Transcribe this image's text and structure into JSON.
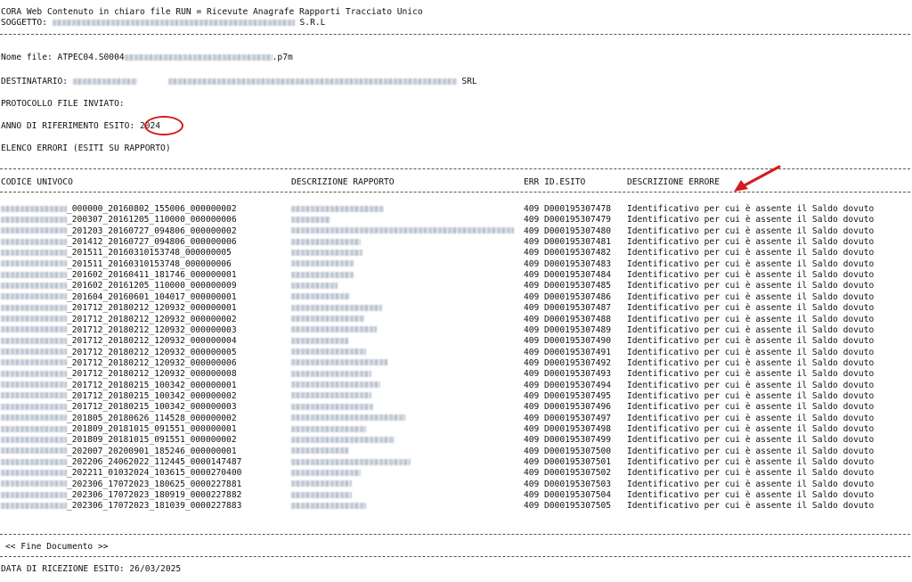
{
  "header": {
    "title": "CORA Web Contenuto in chiaro file RUN = Ricevute Anagrafe Rapporti Tracciato Unico",
    "subject_label": "SOGGETTO:",
    "subject_suffix": "S.R.L"
  },
  "info": {
    "file_name_label": "Nome file:",
    "file_name_prefix": "ATPEC04.S0004",
    "file_name_suffix": ".p7m",
    "recipient_label": "DESTINATARIO:",
    "recipient_suffix": "SRL",
    "protocol_label": "PROTOCOLLO FILE INVIATO:",
    "year_label": "ANNO DI RIFERIMENTO ESITO:",
    "year_value": "2024",
    "errors_heading": "ELENCO ERRORI (ESITI SU RAPPORTO)"
  },
  "table": {
    "headers": {
      "code": "CODICE UNIVOCO",
      "description": "DESCRIZIONE RAPPORTO",
      "err_id": "ERR ID.ESITO",
      "error_description": "DESCRIZIONE ERRORE"
    },
    "rows": [
      {
        "code": "_000000_20160802_155006_000000002",
        "err": "409",
        "id": "D000195307478",
        "msg": "Identificativo per cui è assente il Saldo dovuto"
      },
      {
        "code": "_200307_20161205_110000_000000006",
        "err": "409",
        "id": "D000195307479",
        "msg": "Identificativo per cui è assente il Saldo dovuto"
      },
      {
        "code": "_201203_20160727_094806_000000002",
        "err": "409",
        "id": "D000195307480",
        "msg": "Identificativo per cui è assente il Saldo dovuto"
      },
      {
        "code": "_201412_20160727_094806_000000006",
        "err": "409",
        "id": "D000195307481",
        "msg": "Identificativo per cui è assente il Saldo dovuto"
      },
      {
        "code": "_201511_20160310153748_000000005",
        "err": "409",
        "id": "D000195307482",
        "msg": "Identificativo per cui è assente il Saldo dovuto"
      },
      {
        "code": "_201511_20160310153748_000000006",
        "err": "409",
        "id": "D000195307483",
        "msg": "Identificativo per cui è assente il Saldo dovuto"
      },
      {
        "code": "_201602_20160411_181746_000000001",
        "err": "409",
        "id": "D000195307484",
        "msg": "Identificativo per cui è assente il Saldo dovuto"
      },
      {
        "code": "_201602_20161205_110000_000000009",
        "err": "409",
        "id": "D000195307485",
        "msg": "Identificativo per cui è assente il Saldo dovuto"
      },
      {
        "code": "_201604_20160601_104017_000000001",
        "err": "409",
        "id": "D000195307486",
        "msg": "Identificativo per cui è assente il Saldo dovuto"
      },
      {
        "code": "_201712_20180212_120932_000000001",
        "err": "409",
        "id": "D000195307487",
        "msg": "Identificativo per cui è assente il Saldo dovuto"
      },
      {
        "code": "_201712_20180212_120932_000000002",
        "err": "409",
        "id": "D000195307488",
        "msg": "Identificativo per cui è assente il Saldo dovuto"
      },
      {
        "code": "_201712_20180212_120932_000000003",
        "err": "409",
        "id": "D000195307489",
        "msg": "Identificativo per cui è assente il Saldo dovuto"
      },
      {
        "code": "_201712_20180212_120932_000000004",
        "err": "409",
        "id": "D000195307490",
        "msg": "Identificativo per cui è assente il Saldo dovuto"
      },
      {
        "code": "_201712_20180212_120932_000000005",
        "err": "409",
        "id": "D000195307491",
        "msg": "Identificativo per cui è assente il Saldo dovuto"
      },
      {
        "code": "_201712_20180212_120932_000000006",
        "err": "409",
        "id": "D000195307492",
        "msg": "Identificativo per cui è assente il Saldo dovuto"
      },
      {
        "code": "_201712_20180212_120932_000000008",
        "err": "409",
        "id": "D000195307493",
        "msg": "Identificativo per cui è assente il Saldo dovuto"
      },
      {
        "code": "_201712_20180215_100342_000000001",
        "err": "409",
        "id": "D000195307494",
        "msg": "Identificativo per cui è assente il Saldo dovuto"
      },
      {
        "code": "_201712_20180215_100342_000000002",
        "err": "409",
        "id": "D000195307495",
        "msg": "Identificativo per cui è assente il Saldo dovuto"
      },
      {
        "code": "_201712_20180215_100342_000000003",
        "err": "409",
        "id": "D000195307496",
        "msg": "Identificativo per cui è assente il Saldo dovuto"
      },
      {
        "code": "_201805_20180626_114528_000000002",
        "err": "409",
        "id": "D000195307497",
        "msg": "Identificativo per cui è assente il Saldo dovuto"
      },
      {
        "code": "_201809_20181015_091551_000000001",
        "err": "409",
        "id": "D000195307498",
        "msg": "Identificativo per cui è assente il Saldo dovuto"
      },
      {
        "code": "_201809_20181015_091551_000000002",
        "err": "409",
        "id": "D000195307499",
        "msg": "Identificativo per cui è assente il Saldo dovuto"
      },
      {
        "code": "_202007_20200901_185246_000000001",
        "err": "409",
        "id": "D000195307500",
        "msg": "Identificativo per cui è assente il Saldo dovuto"
      },
      {
        "code": "_202206_24062022_112445_0000147487",
        "err": "409",
        "id": "D000195307501",
        "msg": "Identificativo per cui è assente il Saldo dovuto"
      },
      {
        "code": "_202211_01032024_103615_0000270400",
        "err": "409",
        "id": "D000195307502",
        "msg": "Identificativo per cui è assente il Saldo dovuto"
      },
      {
        "code": "_202306_17072023_180625_0000227881",
        "err": "409",
        "id": "D000195307503",
        "msg": "Identificativo per cui è assente il Saldo dovuto"
      },
      {
        "code": "_202306_17072023_180919_0000227882",
        "err": "409",
        "id": "D000195307504",
        "msg": "Identificativo per cui è assente il Saldo dovuto"
      },
      {
        "code": "_202306_17072023_181039_0000227883",
        "err": "409",
        "id": "D000195307505",
        "msg": "Identificativo per cui è assente il Saldo dovuto"
      }
    ]
  },
  "footer": {
    "end_marker": "<< Fine Documento >>",
    "receipt_date_label": "DATA DI RICEZIONE ESITO:",
    "receipt_date_value": "26/03/2025"
  },
  "annotation": {
    "circle_color": "#d31b1b",
    "arrow_color": "#d31b1b"
  }
}
